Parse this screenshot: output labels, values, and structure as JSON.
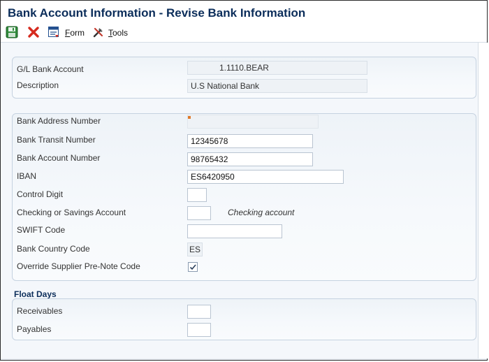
{
  "window": {
    "title": "Bank Account Information - Revise Bank Information"
  },
  "toolbar": {
    "form_label_mnemonic": "F",
    "form_label_rest": "orm",
    "tools_label_mnemonic": "T",
    "tools_label_rest": "ools",
    "icons": [
      "save-icon",
      "close-icon",
      "form-icon",
      "tools-icon"
    ]
  },
  "account": {
    "gl_bank_account_label": "G/L Bank Account",
    "gl_bank_account_value": "1.1110.BEAR",
    "description_label": "Description",
    "description_value": "U.S National Bank"
  },
  "bank": {
    "address_number_label": "Bank Address Number",
    "address_number_value": "",
    "transit_number_label": "Bank Transit Number",
    "transit_number_value": "12345678",
    "account_number_label": "Bank Account Number",
    "account_number_value": "98765432",
    "iban_label": "IBAN",
    "iban_value": "ES6420950",
    "control_digit_label": "Control Digit",
    "control_digit_value": "",
    "checking_savings_label": "Checking or Savings Account",
    "checking_savings_value": "",
    "checking_savings_hint": "Checking account",
    "swift_label": "SWIFT Code",
    "swift_value": "",
    "country_code_label": "Bank Country Code",
    "country_code_value": "ES",
    "override_prenote_label": "Override Supplier Pre-Note Code",
    "override_prenote_checked": true
  },
  "float_days": {
    "title": "Float Days",
    "receivables_label": "Receivables",
    "receivables_value": "",
    "payables_label": "Payables",
    "payables_value": ""
  },
  "colors": {
    "title": "#0b2d5a",
    "section_border": "#c5d2e0",
    "background": "#f4f7fb",
    "close_red": "#d62b1f"
  }
}
